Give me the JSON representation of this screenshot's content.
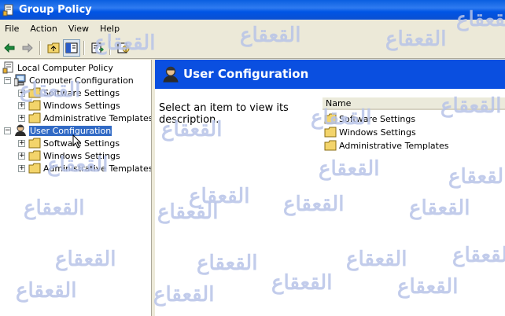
{
  "window": {
    "title": "Group Policy"
  },
  "menubar": {
    "items": [
      "File",
      "Action",
      "View",
      "Help"
    ]
  },
  "toolbar": {
    "buttons": [
      "back-icon",
      "forward-icon",
      "up-folder-icon",
      "show-hide-tree-icon",
      "export-list-icon",
      "help-icon"
    ]
  },
  "tree": {
    "root": "Local Computer Policy",
    "computer": {
      "label": "Computer Configuration",
      "children": [
        "Software Settings",
        "Windows Settings",
        "Administrative Templates"
      ]
    },
    "user": {
      "label": "User Configuration",
      "children": [
        "Software Settings",
        "Windows Settings",
        "Administrative Templates"
      ]
    }
  },
  "detail": {
    "header_title": "User Configuration",
    "description": "Select an item to view its description.",
    "column_name": "Name",
    "items": [
      "Software Settings",
      "Windows Settings",
      "Administrative Templates"
    ]
  },
  "watermark": {
    "text": "القعقاع"
  },
  "colors": {
    "title_blue": "#0A5FE0",
    "header_blue": "#0A4FE0",
    "selection": "#316AC5",
    "folder": "#F3D46B"
  }
}
